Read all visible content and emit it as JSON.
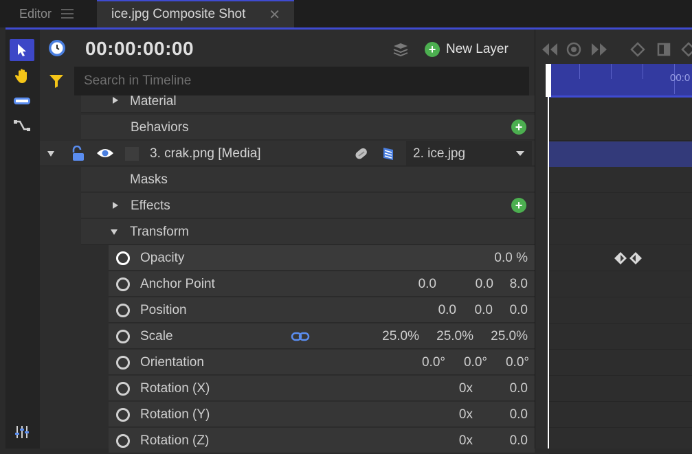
{
  "tabs": {
    "editor": "Editor",
    "composite": "ice.jpg Composite Shot",
    "close_glyph": "✕"
  },
  "header": {
    "timecode": "00:00:00:00",
    "new_layer": "New Layer"
  },
  "search": {
    "placeholder": "Search in Timeline"
  },
  "tree": {
    "material": "Material",
    "behaviors": "Behaviors",
    "layer_name": "3. crak.png [Media]",
    "parent_select": "2. ice.jpg",
    "masks": "Masks",
    "effects": "Effects",
    "transform": "Transform"
  },
  "properties": [
    {
      "name": "Opacity",
      "values": [
        "0.0 %"
      ]
    },
    {
      "name": "Anchor Point",
      "values": [
        "0.0",
        "0.0",
        "8.0"
      ]
    },
    {
      "name": "Position",
      "values": [
        "0.0",
        "0.0",
        "0.0"
      ]
    },
    {
      "name": "Scale",
      "values": [
        "25.0%",
        "25.0%",
        "25.0%"
      ]
    },
    {
      "name": "Orientation",
      "values": [
        "0.0°",
        "0.0°",
        "0.0°"
      ]
    },
    {
      "name": "Rotation (X)",
      "values": [
        "0x",
        "0.0"
      ]
    },
    {
      "name": "Rotation (Y)",
      "values": [
        "0x",
        "0.0"
      ]
    },
    {
      "name": "Rotation (Z)",
      "values": [
        "0x",
        "0.0"
      ]
    }
  ],
  "timeline": {
    "ruler_label": "00:0"
  },
  "colors": {
    "accent": "#3f4bd1",
    "green": "#4caf50",
    "selected_tool": "#3d47c7",
    "yellow_icon": "#f5c518"
  },
  "icons": [
    "select-arrow-icon",
    "hand-icon",
    "razor-icon",
    "curve-icon",
    "mixer-icon",
    "clock-icon",
    "stack-icon",
    "filter-icon",
    "lock-icon",
    "eye-icon",
    "link-icon",
    "blend-icon",
    "prev-keyframe-icon",
    "keyframe-toggle-icon",
    "next-keyframe-icon"
  ]
}
